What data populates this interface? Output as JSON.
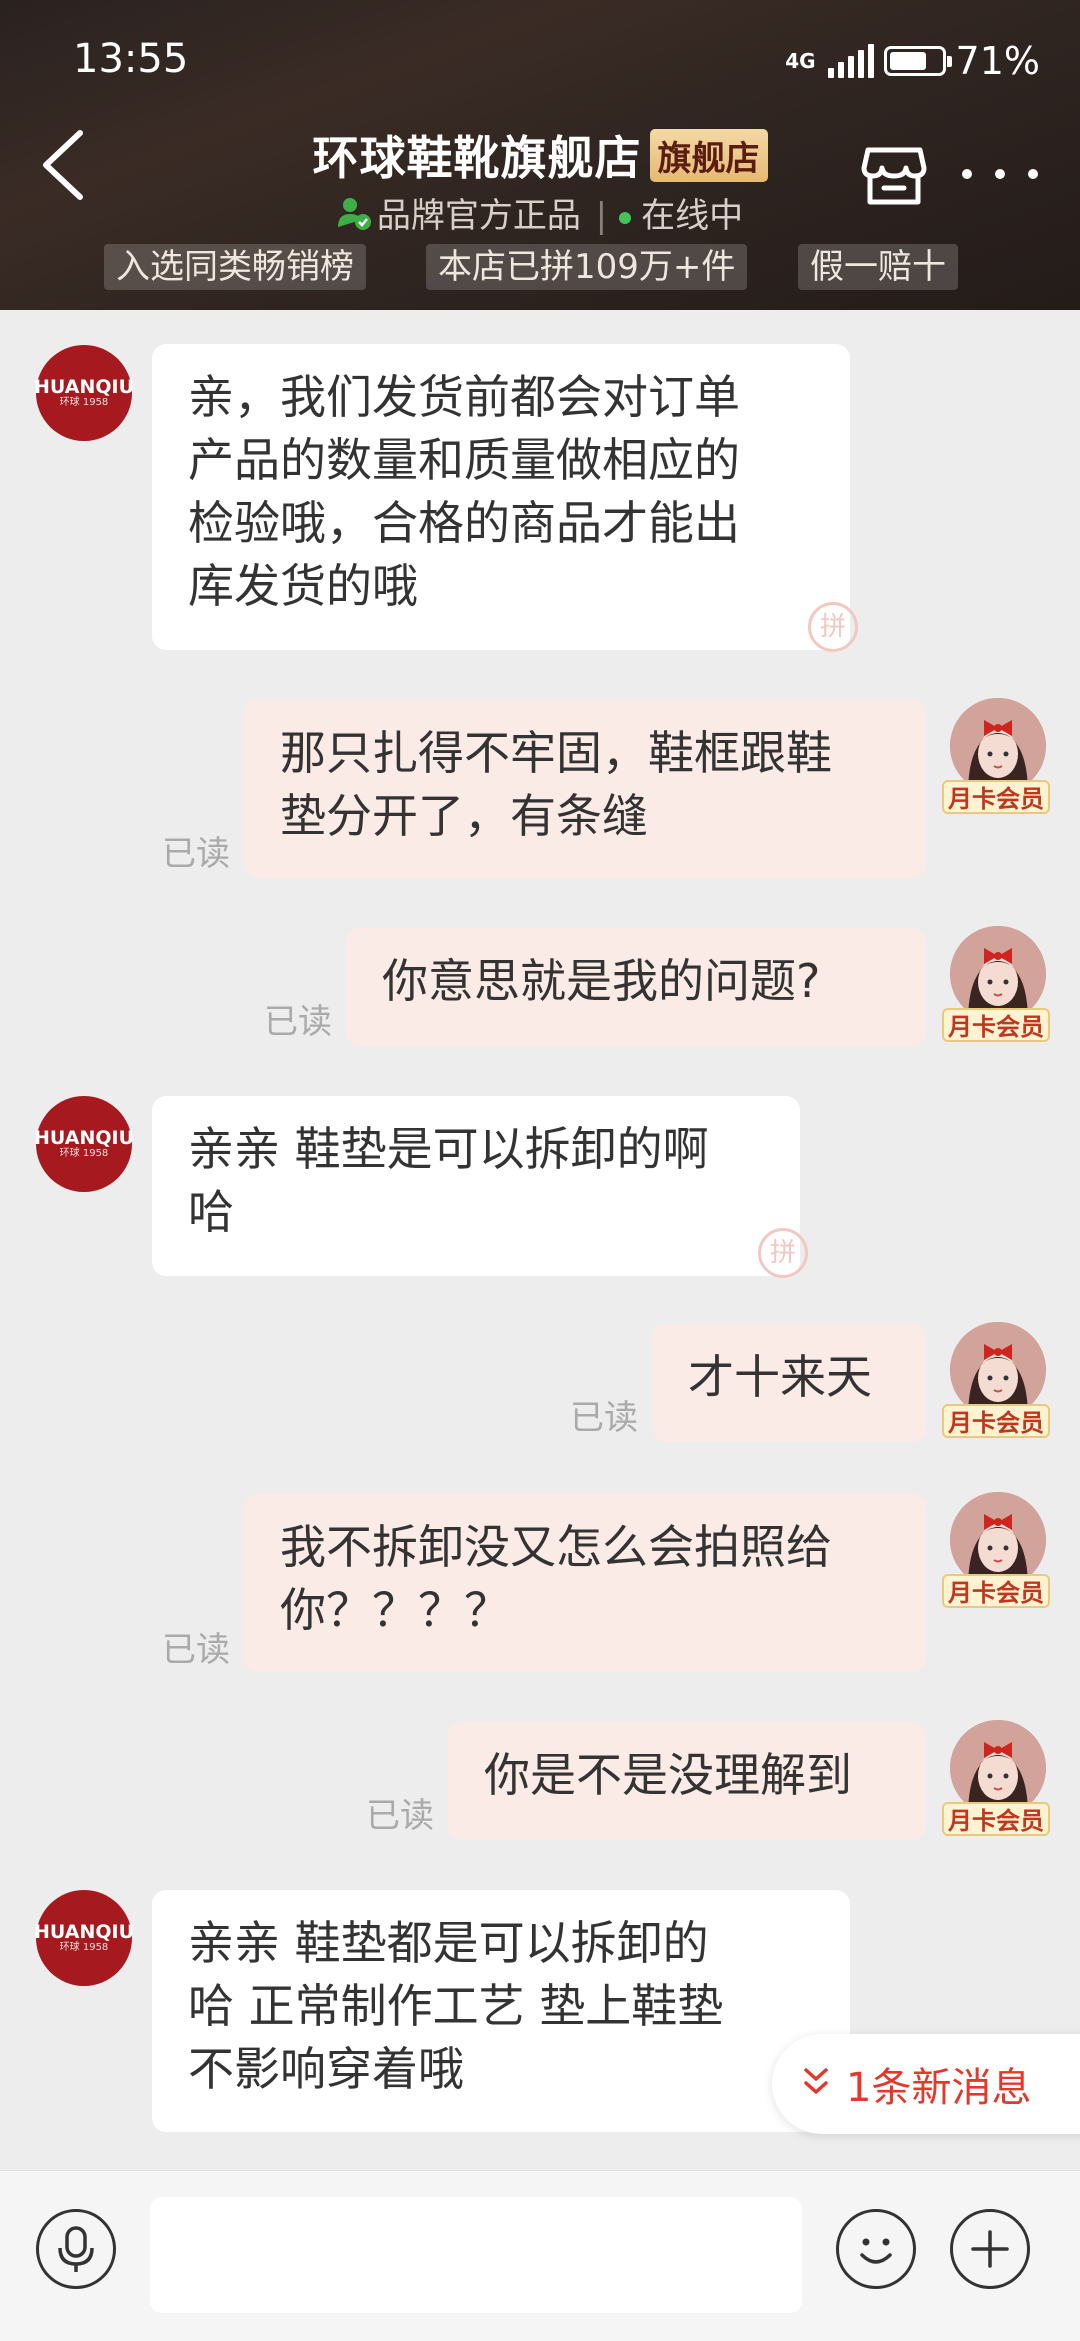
{
  "status_bar": {
    "time": "13:55",
    "network": "4G",
    "battery_pct": "71%",
    "battery_level": 0.71
  },
  "header": {
    "shop_name": "环球鞋靴旗舰店",
    "flag_badge": "旗舰店",
    "verified_text": "品牌官方正品",
    "online_text": "在线中",
    "tags": [
      "入选同类畅销榜",
      "本店已拼109万+件",
      "假一赔十"
    ],
    "icons": {
      "back": "back-arrow-icon",
      "store": "store-icon",
      "more": "more-icon"
    }
  },
  "store_avatar": {
    "brand": "HUANQIU",
    "since": "环球 1958"
  },
  "user_badge": "月卡会员",
  "read_label": "已读",
  "pin_mark": "拼",
  "messages": [
    {
      "from": "store",
      "lines": [
        "亲，我们发货前都会对订单",
        "产品的数量和质量做相应的",
        "检验哦，合格的商品才能出",
        "库发货的哦"
      ]
    },
    {
      "from": "user",
      "lines": [
        "那只扎得不牢固，鞋框跟鞋",
        "垫分开了，有条缝"
      ],
      "read": true
    },
    {
      "from": "user",
      "lines": [
        "你意思就是我的问题?"
      ],
      "read": true
    },
    {
      "from": "store",
      "lines": [
        "亲亲 鞋垫是可以拆卸的啊",
        "哈"
      ]
    },
    {
      "from": "user",
      "lines": [
        "才十来天"
      ],
      "read": true
    },
    {
      "from": "user",
      "lines": [
        "我不拆卸没又怎么会拍照给",
        "你？？？？"
      ],
      "read": true
    },
    {
      "from": "user",
      "lines": [
        "你是不是没理解到"
      ],
      "read": true
    },
    {
      "from": "store",
      "lines": [
        "亲亲  鞋垫都是可以拆卸的",
        "哈  正常制作工艺  垫上鞋垫",
        "不影响穿着哦"
      ]
    }
  ],
  "new_message_tip": "1条新消息",
  "input_bar": {
    "placeholder": "",
    "icons": [
      "microphone-icon",
      "emoji-icon",
      "plus-icon"
    ]
  },
  "colors": {
    "header_bg": "#2e2420",
    "accent_red": "#e5382b",
    "out_bubble": "#fbebe7",
    "online": "#43c45a"
  }
}
